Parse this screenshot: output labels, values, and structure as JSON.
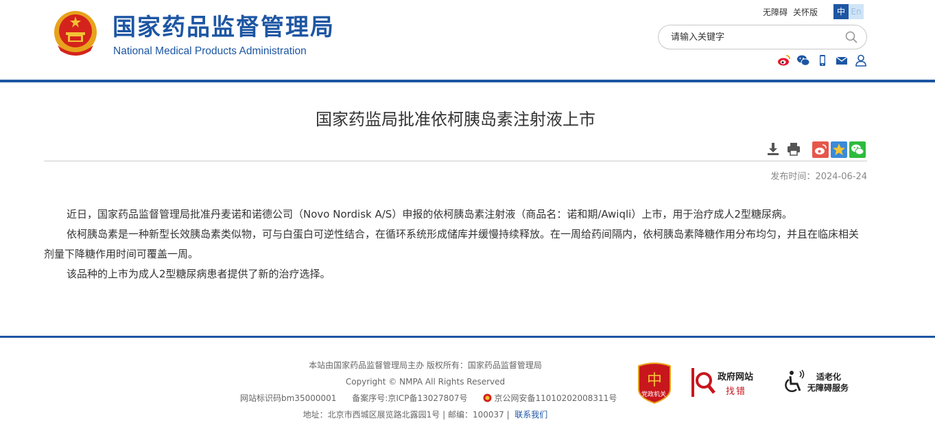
{
  "header": {
    "brand_cn": "国家药品监督管理局",
    "brand_en": "National Medical Products Administration",
    "links": [
      "无障碍",
      "关怀版"
    ],
    "lang_zh": "中",
    "lang_en": "En",
    "search_placeholder": "请输入关键字",
    "social_icons": [
      "weibo-icon",
      "wechat-icon",
      "mobile-icon",
      "mail-icon",
      "user-icon"
    ]
  },
  "article": {
    "title": "国家药监局批准依柯胰岛素注射液上市",
    "tools": [
      "download-icon",
      "print-icon"
    ],
    "share": [
      "weibo-share-icon",
      "qzone-share-icon",
      "wechat-share-icon"
    ],
    "publish_label": "发布时间：",
    "publish_date": "2024-06-24",
    "paragraphs": [
      "近日，国家药品监督管理局批准丹麦诺和诺德公司（Novo Nordisk A/S）申报的依柯胰岛素注射液（商品名：诺和期/Awiqli）上市，用于治疗成人2型糖尿病。",
      "依柯胰岛素是一种新型长效胰岛素类似物，可与白蛋白可逆性结合，在循环系统形成储库并缓慢持续释放。在一周给药间隔内，依柯胰岛素降糖作用分布均匀，并且在临床相关剂量下降糖作用时间可覆盖一周。",
      "该品种的上市为成人2型糖尿病患者提供了新的治疗选择。"
    ]
  },
  "footer": {
    "line1": "本站由国家药品监督管理局主办 版权所有：国家药品监督管理局",
    "line2": "Copyright © NMPA All Rights Reserved",
    "site_id": "网站标识码bm35000001",
    "icp": "备案序号:京ICP备13027807号",
    "police": "京公网安备11010202008311号",
    "address": "地址：北京市西城区展览路北露园1号 | 邮编：100037 |",
    "contact": "联系我们",
    "badge_party": "党政机关",
    "badge_gov_title": "政府网站",
    "badge_gov_sub": "找错",
    "badge_access_1": "适老化",
    "badge_access_2": "无障碍服务"
  },
  "colors": {
    "brand_blue": "#1d56a3",
    "red": "#c8161d"
  }
}
